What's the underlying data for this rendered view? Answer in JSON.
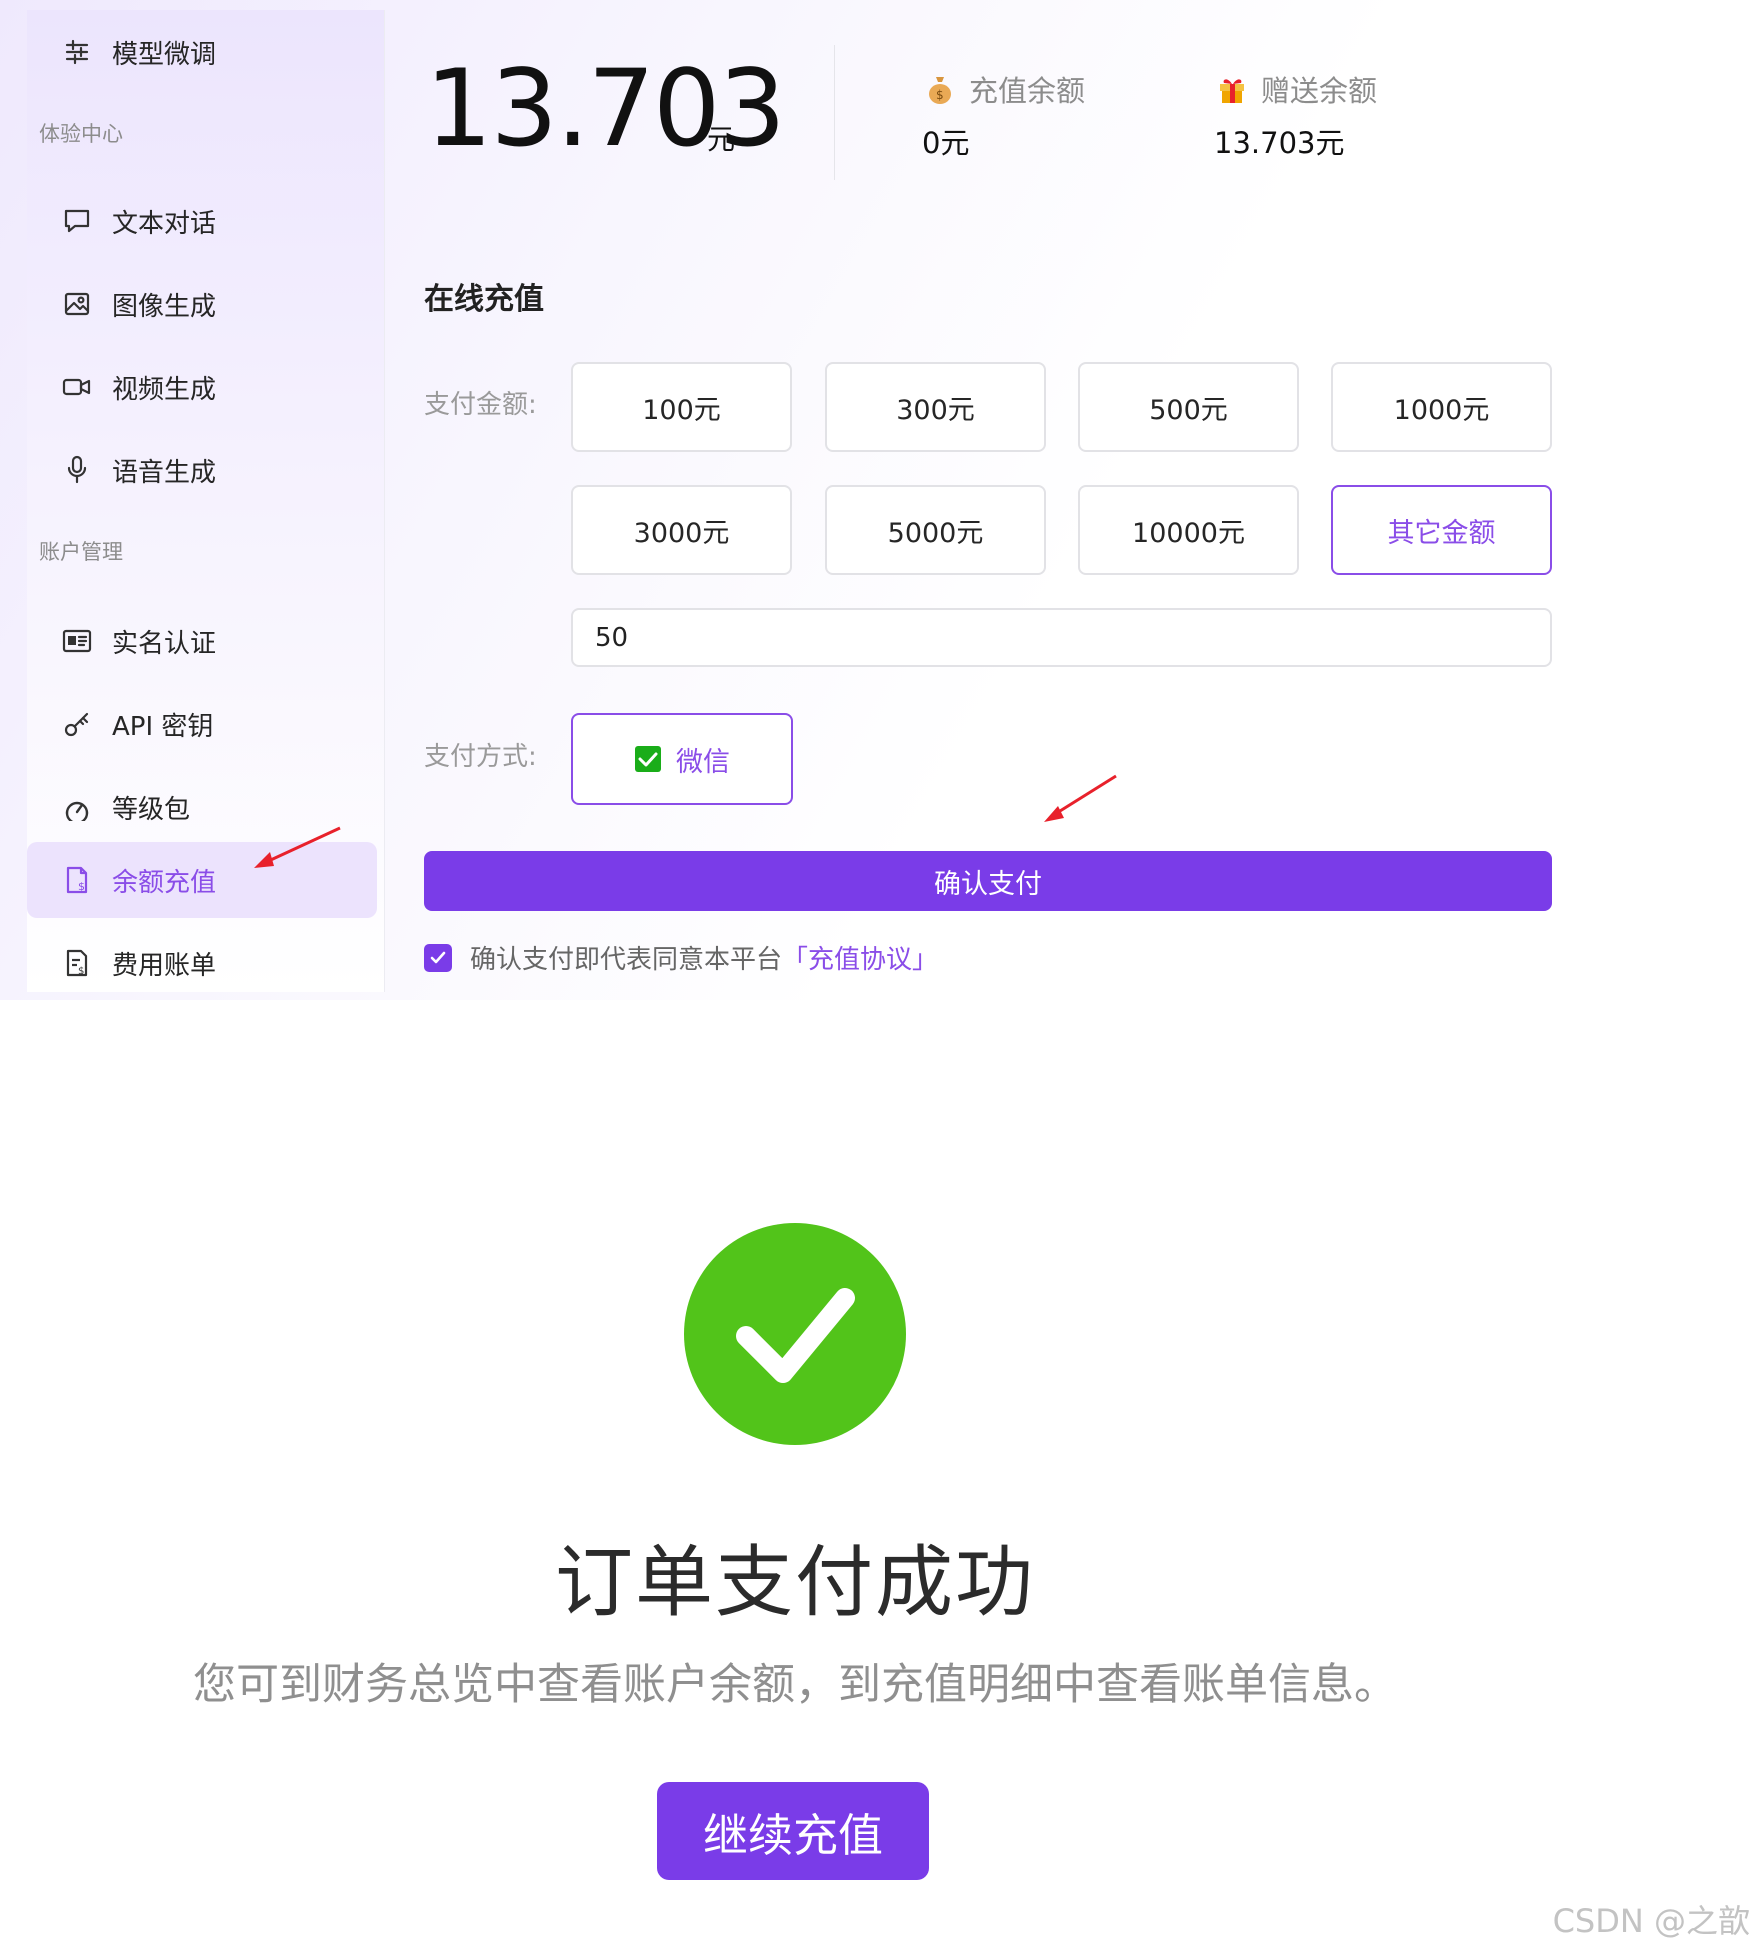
{
  "sidebar": {
    "top_item": {
      "label": "模型微调",
      "icon": "sliders-icon"
    },
    "sections": [
      {
        "title": "体验中心",
        "items": [
          {
            "label": "文本对话",
            "icon": "chat-bubble-icon"
          },
          {
            "label": "图像生成",
            "icon": "image-icon"
          },
          {
            "label": "视频生成",
            "icon": "video-camera-icon"
          },
          {
            "label": "语音生成",
            "icon": "microphone-icon"
          }
        ]
      },
      {
        "title": "账户管理",
        "items": [
          {
            "label": "实名认证",
            "icon": "id-card-icon"
          },
          {
            "label": "API 密钥",
            "icon": "key-icon"
          },
          {
            "label": "等级包",
            "icon": "gauge-icon"
          },
          {
            "label": "余额充值",
            "icon": "wallet-recharge-icon",
            "active": true
          },
          {
            "label": "费用账单",
            "icon": "bill-icon"
          }
        ]
      }
    ]
  },
  "balance": {
    "total": "13.703",
    "unit": "元",
    "recharge_label": "充值余额",
    "recharge_value": "0元",
    "gift_label": "赠送余额",
    "gift_value": "13.703元"
  },
  "recharge": {
    "title": "在线充值",
    "amount_label": "支付金额:",
    "amounts": [
      "100元",
      "300元",
      "500元",
      "1000元",
      "3000元",
      "5000元",
      "10000元",
      "其它金额"
    ],
    "selected_amount": "其它金额",
    "custom_amount_value": "50",
    "method_label": "支付方式:",
    "method": "微信",
    "confirm_label": "确认支付",
    "agreement_text": "确认支付即代表同意本平台",
    "agreement_link": "「充值协议」",
    "agreement_checked": true
  },
  "success": {
    "title": "订单支付成功",
    "description": "您可到财务总览中查看账户余额，到充值明细中查看账单信息。",
    "continue_label": "继续充值"
  },
  "watermark": "CSDN @之歆",
  "colors": {
    "accent": "#7a3ce8",
    "accent_light": "#8a4de8",
    "success": "#52c41a",
    "annotation_arrow": "#e8212b"
  }
}
